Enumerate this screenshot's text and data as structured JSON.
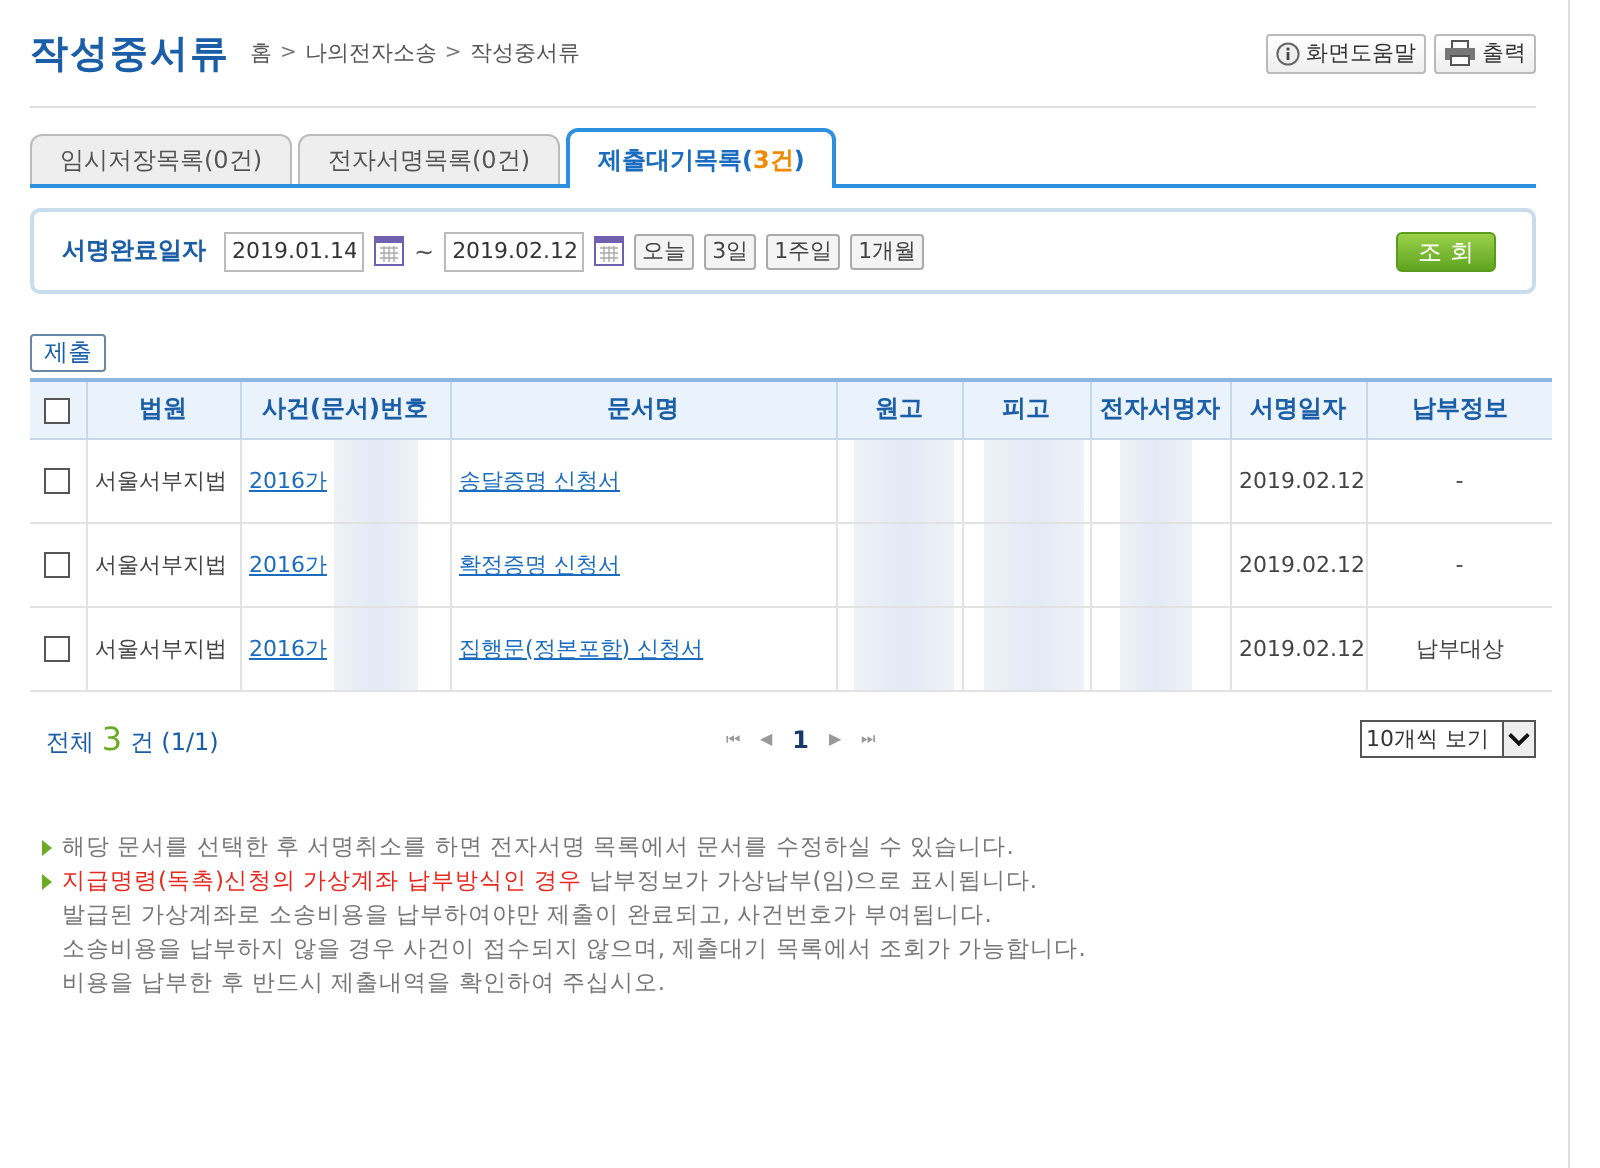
{
  "page_title": "작성중서류",
  "breadcrumb": [
    "홈",
    "나의전자소송",
    "작성중서류"
  ],
  "breadcrumb_separator": ">",
  "header_buttons": [
    {
      "kind": "help",
      "label": "화면도움말"
    },
    {
      "kind": "print",
      "label": "출력"
    }
  ],
  "tabs": [
    {
      "label": "임시저장목록(0건)",
      "selected": false
    },
    {
      "label": "전자서명목록(0건)",
      "selected": false
    },
    {
      "label": "제출대기목록(",
      "count": "3건",
      "suffix": ")",
      "selected": true
    }
  ],
  "search": {
    "label": "서명완료일자",
    "from": "2019.01.14",
    "separator": "~",
    "to": "2019.02.12",
    "quick_ranges": [
      "오늘",
      "3일",
      "1주일",
      "1개월"
    ],
    "submit": "조 회"
  },
  "submit_button": "제출",
  "table": {
    "all_checked": false,
    "columns": [
      "법원",
      "사건(문서)번호",
      "문서명",
      "원고",
      "피고",
      "전자서명자",
      "서명일자",
      "납부정보"
    ],
    "rows": [
      {
        "checked": false,
        "court": "서울서부지법",
        "case_no": "2016가",
        "document": "송달증명 신청서",
        "blurred": true,
        "date": "2019.02.12",
        "payment": "-"
      },
      {
        "checked": false,
        "court": "서울서부지법",
        "case_no": "2016가",
        "document": "확정증명 신청서",
        "blurred": true,
        "date": "2019.02.12",
        "payment": "-"
      },
      {
        "checked": false,
        "court": "서울서부지법",
        "case_no": "2016가",
        "document": "집행문(정본포함) 신청서",
        "blurred": true,
        "date": "2019.02.12",
        "payment": "납부대상"
      }
    ]
  },
  "summary": {
    "prefix": "전체",
    "count": "3",
    "suffix": "건",
    "pages": "(1/1)"
  },
  "pagination": {
    "first": "⏮",
    "prev": "◀",
    "pages": [
      {
        "label": "1",
        "selected": true
      }
    ],
    "next": "▶",
    "last": "⏭"
  },
  "page_size": "10개씩 보기",
  "notes": [
    {
      "lines": [
        "해당 문서를 선택한 후 서명취소를 하면 전자서명 목록에서 문서를 수정하실 수 있습니다."
      ]
    },
    {
      "highlight": "지급명령(독촉)신청의 가상계좌 납부방식인 경우",
      "lines": [
        "납부정보가 가상납부(임)으로 표시됩니다.",
        "발급된 가상계좌로 소송비용을 납부하여야만 제출이 완료되고, 사건번호가 부여됩니다.",
        "소송비용을 납부하지 않을 경우 사건이 접수되지 않으며, 제출대기 목록에서 조회가 가능합니다.",
        "비용을 납부한 후 반드시 제출내역을 확인하여 주십시오."
      ]
    }
  ]
}
